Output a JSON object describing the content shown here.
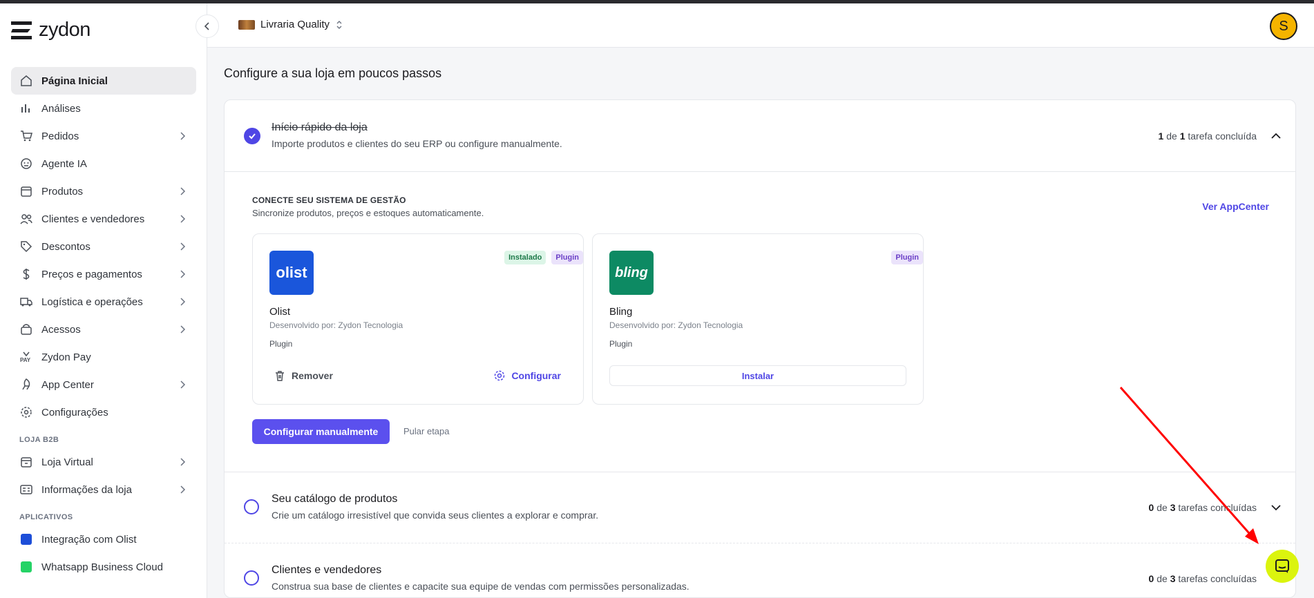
{
  "app": {
    "name": "zydon"
  },
  "header": {
    "store_name": "Livraria Quality",
    "avatar_initial": "S"
  },
  "sidebar": {
    "items": [
      {
        "label": "Página Inicial",
        "icon": "home-icon",
        "active": true,
        "chevron": false
      },
      {
        "label": "Análises",
        "icon": "bar-chart-icon",
        "chevron": false
      },
      {
        "label": "Pedidos",
        "icon": "cart-icon",
        "chevron": true
      },
      {
        "label": "Agente IA",
        "icon": "bot-icon",
        "chevron": false
      },
      {
        "label": "Produtos",
        "icon": "box-icon",
        "chevron": true
      },
      {
        "label": "Clientes e vendedores",
        "icon": "users-icon",
        "chevron": true
      },
      {
        "label": "Descontos",
        "icon": "tag-icon",
        "chevron": true
      },
      {
        "label": "Preços e pagamentos",
        "icon": "dollar-icon",
        "chevron": true
      },
      {
        "label": "Logística e operações",
        "icon": "truck-icon",
        "chevron": true
      },
      {
        "label": "Acessos",
        "icon": "key-icon",
        "chevron": true
      },
      {
        "label": "Zydon Pay",
        "icon": "pay-icon",
        "chevron": false
      },
      {
        "label": "App Center",
        "icon": "rocket-icon",
        "chevron": true
      },
      {
        "label": "Configurações",
        "icon": "gear-icon",
        "chevron": false
      }
    ],
    "b2b_section": {
      "title": "LOJA B2B",
      "items": [
        {
          "label": "Loja Virtual",
          "icon": "store-icon",
          "chevron": true
        },
        {
          "label": "Informações da loja",
          "icon": "info-card-icon",
          "chevron": true
        }
      ]
    },
    "apps_section": {
      "title": "APLICATIVOS",
      "items": [
        {
          "label": "Integração com Olist",
          "icon": "olist-app-icon",
          "color": "#1d4ed8"
        },
        {
          "label": "Whatsapp Business Cloud",
          "icon": "whatsapp-icon",
          "color": "#25d366"
        }
      ]
    }
  },
  "main": {
    "title": "Configure a sua loja em poucos passos",
    "steps": [
      {
        "title": "Início rápido da loja",
        "description": "Importe produtos e clientes do seu ERP ou configure manualmente.",
        "done_count": "1",
        "total_count": "1",
        "count_sep": "de",
        "count_suffix": "tarefa concluída"
      },
      {
        "title": "Seu catálogo de produtos",
        "description": "Crie um catálogo irresistível que convida seus clientes a explorar e comprar.",
        "done_count": "0",
        "total_count": "3",
        "count_sep": "de",
        "count_suffix": "tarefas concluídas"
      },
      {
        "title": "Clientes e vendedores",
        "description": "Construa sua base de clientes e capacite sua equipe de vendas com permissões personalizadas.",
        "done_count": "0",
        "total_count": "3",
        "count_sep": "de",
        "count_suffix": "tarefas concluídas"
      }
    ],
    "erp": {
      "title": "CONECTE SEU SISTEMA DE GESTÃO",
      "subtitle": "Sincronize produtos, preços e estoques automaticamente.",
      "appcenter_link": "Ver AppCenter",
      "plugins": [
        {
          "name": "Olist",
          "logo_text": "olist",
          "logo_color": "#1a56db",
          "developer": "Desenvolvido por: Zydon Tecnologia",
          "type": "Plugin",
          "badge_installed": "Instalado",
          "badge_plugin": "Plugin",
          "remove_label": "Remover",
          "configure_label": "Configurar"
        },
        {
          "name": "Bling",
          "logo_text": "bling",
          "logo_color": "#0d8a63",
          "developer": "Desenvolvido por: Zydon Tecnologia",
          "type": "Plugin",
          "badge_plugin": "Plugin",
          "install_label": "Instalar"
        }
      ],
      "manual_button": "Configurar manualmente",
      "skip_link": "Pular etapa"
    }
  },
  "colors": {
    "accent": "#4f46e5",
    "chat_bubble": "#dbf40e",
    "annotation_arrow": "#ff0000"
  }
}
